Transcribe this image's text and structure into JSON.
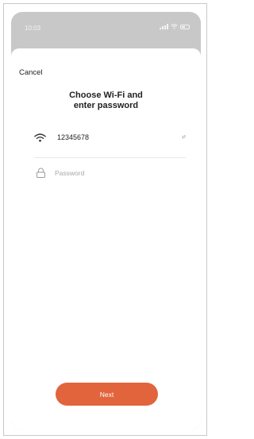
{
  "status_bar": {
    "time": "10:03",
    "icons": [
      "location-arrow-icon",
      "cellular-signal-icon",
      "wifi-icon",
      "battery-icon"
    ]
  },
  "nav": {
    "cancel_label": "Cancel"
  },
  "form": {
    "title_line1": "Choose Wi-Fi and",
    "title_line2": "enter password",
    "ssid": "12345678",
    "switch_wifi_label": "⇄",
    "password_placeholder": "Password",
    "password_value": ""
  },
  "actions": {
    "next_label": "Next"
  },
  "colors": {
    "accent": "#e2643c",
    "backdrop": "#c8c8c8",
    "text": "#222222",
    "placeholder": "#a8a8a8"
  }
}
